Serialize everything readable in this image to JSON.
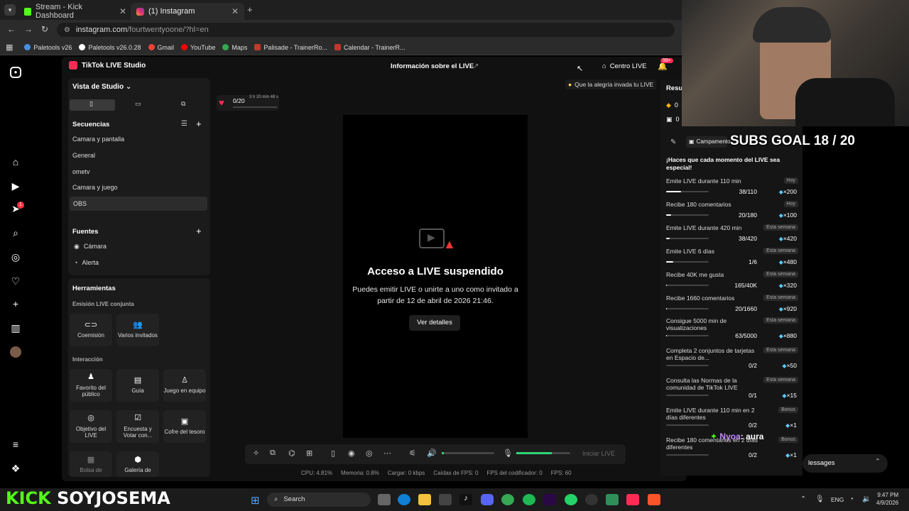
{
  "browser": {
    "tabs": [
      {
        "title": "Stream - Kick Dashboard",
        "active": false
      },
      {
        "title": "(1) Instagram",
        "active": true
      }
    ],
    "new_tab": "+",
    "url": "instagram.com",
    "url_path": "/fourtwentyoone/?hl=en",
    "bookmarks": [
      "Paletools v26",
      "Paletools v26.0.28",
      "Gmail",
      "YouTube",
      "Maps",
      "Palisade - TrainerRo...",
      "Calendar - TrainerR..."
    ]
  },
  "studio": {
    "app_title": "TikTok LIVE Studio",
    "info_title": "Información sobre el LIVE",
    "centro_live": "Centro LIVE",
    "notif_badge": "99+",
    "tip": "Que la alegría invada tu LIVE",
    "view_label": "Vista de Studio",
    "sequences_label": "Secuencias",
    "sequences": [
      "Camara y pantalla",
      "General",
      "ometv",
      "Camara y juego",
      "OBS"
    ],
    "selected_sequence": "OBS",
    "sources_label": "Fuentes",
    "sources": [
      "Cámara",
      "Alerta"
    ],
    "tools_label": "Herramientas",
    "cohost_label": "Emisión LIVE conjunta",
    "cohost_tools": [
      "Coemisión",
      "Varios invitados"
    ],
    "interaction_label": "Interacción",
    "interaction_tools": [
      "Favorito del público",
      "Guía",
      "Juego en equipo",
      "Objetivo del LIVE",
      "Encuesta y Votar con...",
      "Cofre del tesoro",
      "Bolsa de",
      "Galería de"
    ],
    "like_counter": "0/20",
    "like_timer": "3 h 20 min 48 s",
    "suspended_title": "Acceso a LIVE suspendido",
    "suspended_text": "Puedes emitir LIVE o unirte a uno como invitado a partir de 12 de abril de 2026 21:46.",
    "details_button": "Ver detalles",
    "start_live": "Iniciar LIVE",
    "stats": {
      "cpu": "CPU: 4.81%",
      "memory": "Memoria: 0.8%",
      "upload": "Cargar: 0 kbps",
      "fps_drops": "Caídas de FPS: 0",
      "encoder_fps": "FPS del codificador: 0",
      "fps": "FPS: 60"
    }
  },
  "rightpanel": {
    "results_label": "Resu",
    "diamonds": "0",
    "gifts": "0",
    "campaign": "Campamento",
    "headline": "¡Haces que cada momento del LIVE sea especial!",
    "missions": [
      {
        "title": "Emite LIVE durante 110 min",
        "tag": "Hoy",
        "count": "38/110",
        "progress": 0.35,
        "reward": "×200"
      },
      {
        "title": "Recibe 180 comentarios",
        "tag": "Hoy",
        "count": "20/180",
        "progress": 0.11,
        "reward": "×100"
      },
      {
        "title": "Emite LIVE durante 420 min",
        "tag": "Esta semana",
        "count": "38/420",
        "progress": 0.09,
        "reward": "×420"
      },
      {
        "title": "Emite LIVE 6 días",
        "tag": "Esta semana",
        "count": "1/6",
        "progress": 0.17,
        "reward": "×480"
      },
      {
        "title": "Recibe 40K me gusta",
        "tag": "Esta semana",
        "count": "165/40K",
        "progress": 0.01,
        "reward": "×320"
      },
      {
        "title": "Recibe 1660 comentarios",
        "tag": "Esta semana",
        "count": "20/1660",
        "progress": 0.01,
        "reward": "×920"
      },
      {
        "title": "Consigue 5000 min de visualizaciones",
        "tag": "Esta semana",
        "count": "63/5000",
        "progress": 0.01,
        "reward": "×880"
      },
      {
        "title": "Completa 2 conjuntos de tarjetas en Espacio de...",
        "tag": "Esta semana",
        "count": "0/2",
        "progress": 0,
        "reward": "×50"
      },
      {
        "title": "Consulta las Normas de la comunidad de TikTok LIVE",
        "tag": "Esta semana",
        "count": "0/1",
        "progress": 0,
        "reward": "×15"
      },
      {
        "title": "Emite LIVE durante 110 min en 2 días diferentes",
        "tag": "Bonus",
        "count": "0/2",
        "progress": 0,
        "reward": "×1"
      },
      {
        "title": "Recibe 180 comentarios en 2 días diferentes",
        "tag": "Bonus",
        "count": "0/2",
        "progress": 0,
        "reward": "×1"
      }
    ]
  },
  "overlay": {
    "subs_goal": "SUBS GOAL 18 / 20",
    "chat_user": "Nyoa",
    "chat_text": ": aura",
    "messages_label": "lessages",
    "brand_left": "KICK",
    "brand_right": "SOYJOSEMA"
  },
  "taskbar": {
    "search": "Search",
    "lang": "ENG",
    "time": "9:47 PM",
    "date": "4/9/2026"
  },
  "ig_notif_badge": "1"
}
